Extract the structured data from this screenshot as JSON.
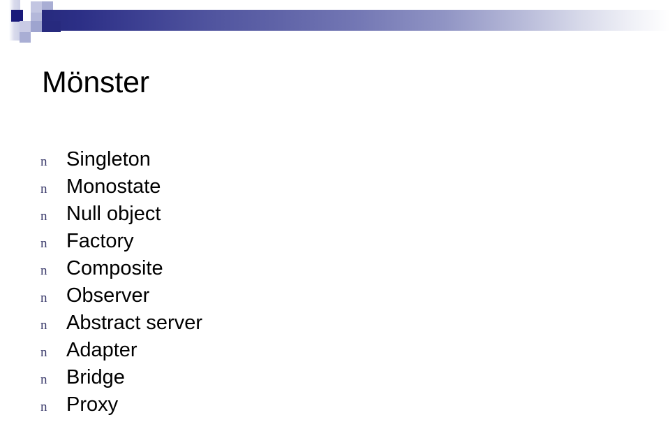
{
  "slide": {
    "title": "Mönster",
    "bullet_marker": "n",
    "bullet_marker_icon": "square-bullet-icon",
    "background_color": "#ffffff",
    "title_color": "#000000",
    "bullet_marker_color": "#3a3a6b",
    "items": [
      {
        "label": "Singleton"
      },
      {
        "label": "Monostate"
      },
      {
        "label": "Null object"
      },
      {
        "label": "Factory"
      },
      {
        "label": "Composite"
      },
      {
        "label": "Observer"
      },
      {
        "label": "Abstract server"
      },
      {
        "label": "Adapter"
      },
      {
        "label": "Bridge"
      },
      {
        "label": "Proxy"
      }
    ]
  },
  "header": {
    "accent_dark": "#272a7e",
    "accent_navy": "#1a1a7a",
    "accent_lavender": "#b4b8da",
    "accent_light": "#c9cbe5"
  }
}
